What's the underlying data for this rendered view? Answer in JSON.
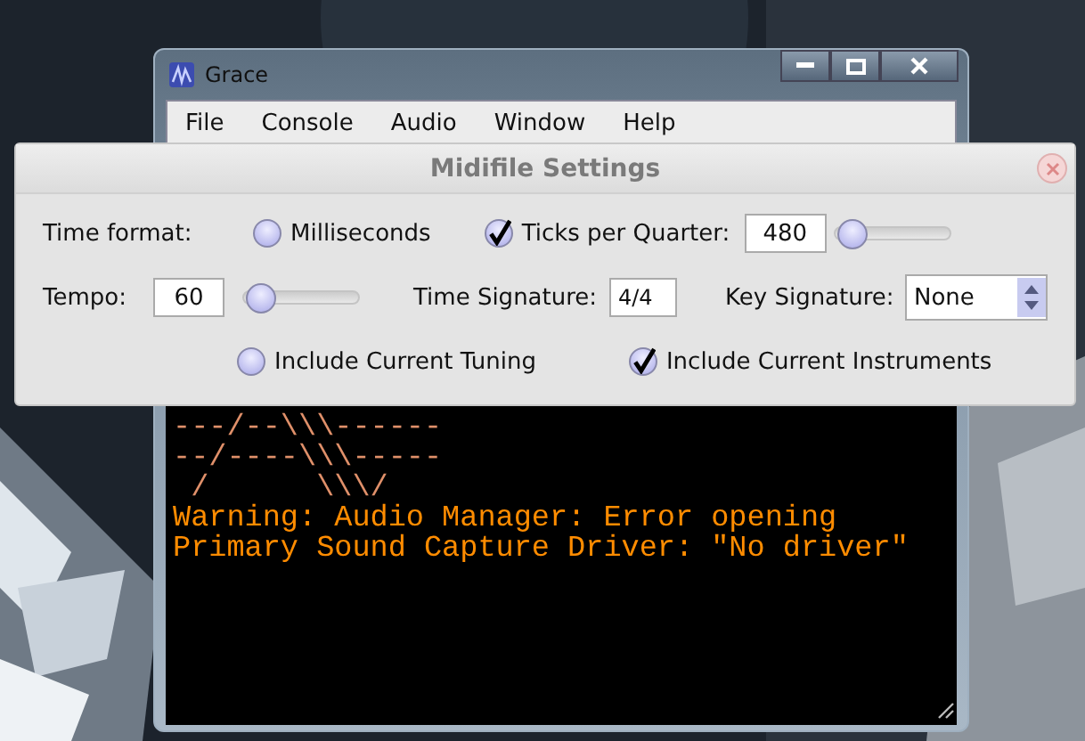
{
  "window": {
    "title": "Grace"
  },
  "menu": [
    {
      "label": "File"
    },
    {
      "label": "Console"
    },
    {
      "label": "Audio"
    },
    {
      "label": "Window"
    },
    {
      "label": "Help"
    }
  ],
  "console": [
    {
      "kind": "art",
      "text": "---/--\\\\\\------"
    },
    {
      "kind": "art",
      "text": "--/----\\\\\\-----"
    },
    {
      "kind": "art",
      "text": " /      \\\\\\/"
    },
    {
      "kind": "warning",
      "text": "Warning: Audio Manager: Error opening"
    },
    {
      "kind": "warning",
      "text": "Primary Sound Capture Driver: \"No driver\""
    }
  ],
  "dialog": {
    "title": "Midifile Settings",
    "time_format": {
      "label": "Time format:",
      "options": [
        {
          "label": "Milliseconds",
          "selected": false
        },
        {
          "label": "Ticks per Quarter:",
          "selected": true
        }
      ],
      "ticks": {
        "value": "480",
        "level": 0.05
      }
    },
    "tempo": {
      "label": "Tempo:",
      "value": "60",
      "level": 0.05
    },
    "time_signature": {
      "label": "Time Signature:",
      "value": "4/4"
    },
    "key_signature": {
      "label": "Key Signature:",
      "value": "None"
    },
    "options": [
      {
        "label": "Include Current Tuning",
        "checked": false
      },
      {
        "label": "Include Current Instruments",
        "checked": true
      }
    ]
  }
}
